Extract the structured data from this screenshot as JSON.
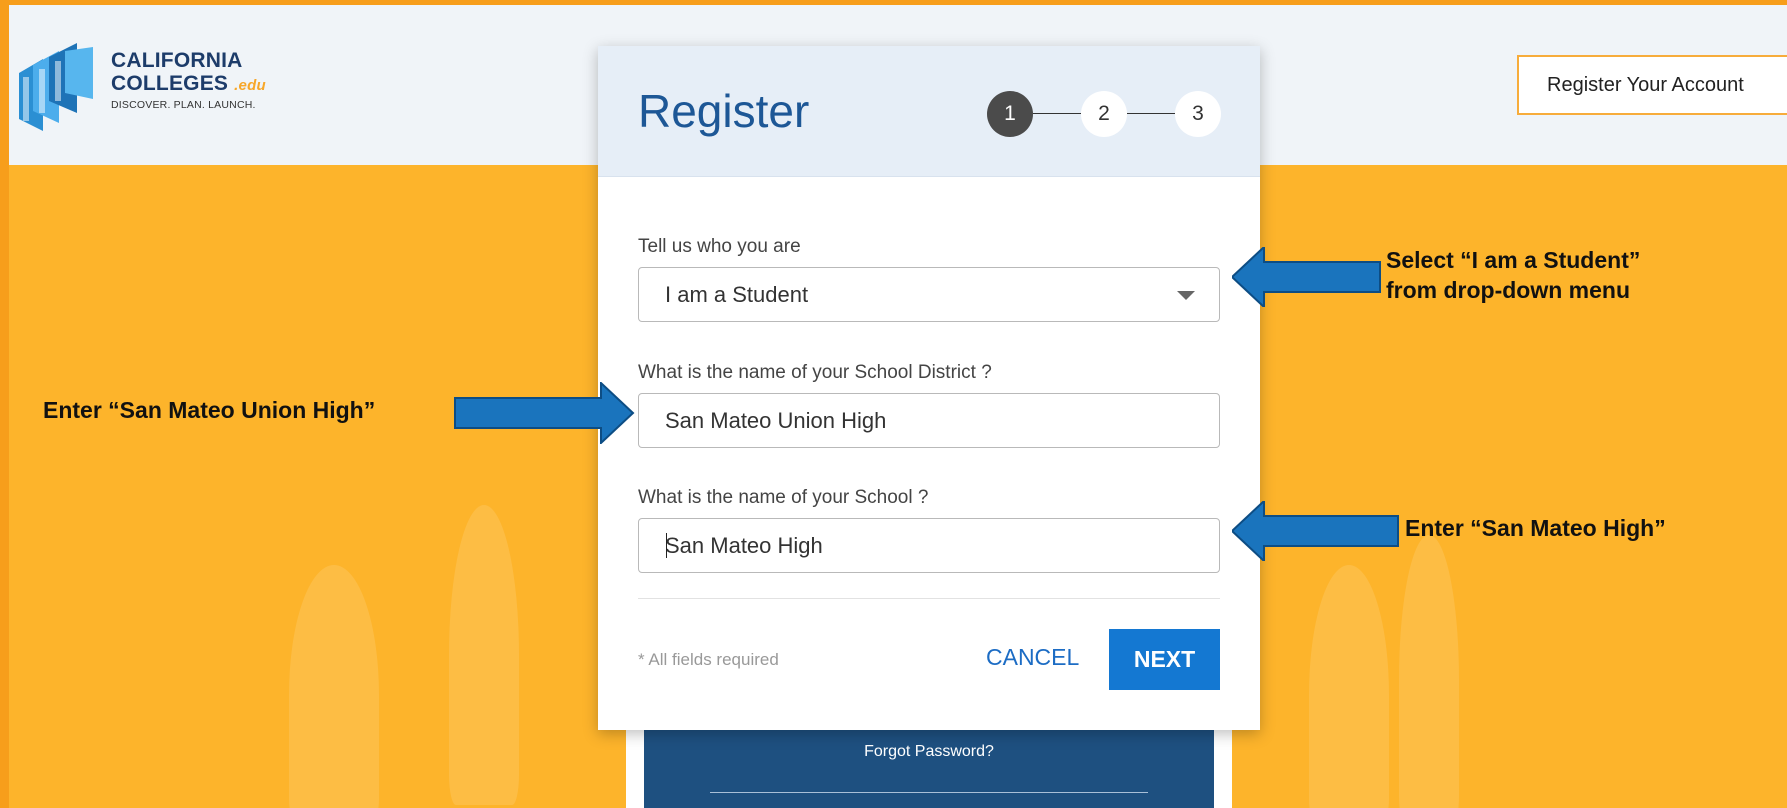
{
  "header": {
    "logo": {
      "line1": "CALIFORNIA",
      "line2": "COLLEGES",
      "edu": ".edu",
      "tagline": "DISCOVER. PLAN. LAUNCH."
    },
    "register_account_label": "Register Your Account"
  },
  "modal": {
    "title": "Register",
    "steps": [
      "1",
      "2",
      "3"
    ],
    "active_step": 1,
    "fields": [
      {
        "label": "Tell us who you are",
        "value": "I am a Student",
        "type": "select"
      },
      {
        "label": "What is the name of your School District ?",
        "value": "San Mateo Union High",
        "type": "text"
      },
      {
        "label": "What is the name of your School ?",
        "value": "San Mateo High",
        "type": "text"
      }
    ],
    "required_note": "* All fields required",
    "cancel_label": "CANCEL",
    "next_label": "NEXT"
  },
  "back_panel": {
    "forgot_password": "Forgot Password?"
  },
  "annotations": {
    "select_line1": "Select “I am a Student”",
    "select_line2": "from drop-down menu",
    "district": "Enter “San Mateo Union High”",
    "school": "Enter “San Mateo High”"
  },
  "colors": {
    "background": "#fdb42b",
    "brand_blue": "#1d5796",
    "next_button": "#1478d2",
    "arrow_blue": "#1a74bd"
  }
}
